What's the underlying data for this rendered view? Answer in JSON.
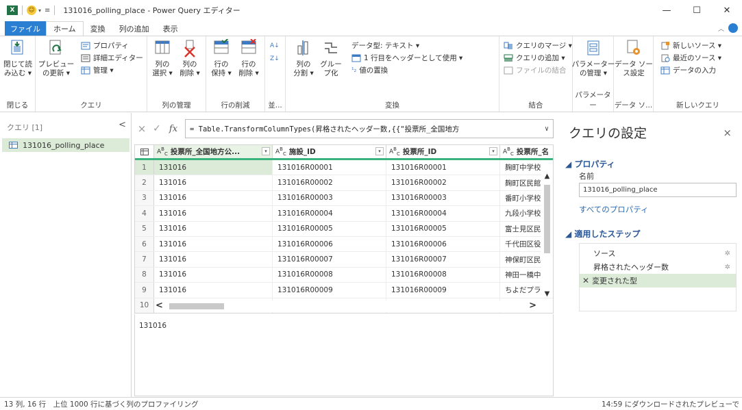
{
  "window": {
    "title": "131016_polling_place - Power Query エディター",
    "app_icon_text": "X",
    "smiley": "☺"
  },
  "ribbon_tabs": [
    "ファイル",
    "ホーム",
    "変換",
    "列の追加",
    "表示"
  ],
  "ribbon": {
    "close": {
      "load_label": "閉じて読\nみ込む ▾",
      "group": "閉じる"
    },
    "query": {
      "preview_label": "プレビュー\nの更新 ▾",
      "properties": "プロパティ",
      "advanced_editor": "詳細エディター",
      "manage": "管理 ▾",
      "group": "クエリ"
    },
    "manage_columns": {
      "choose": "列の\n選択 ▾",
      "remove": "列の\n削除 ▾",
      "group": "列の管理"
    },
    "reduce_rows": {
      "keep": "行の\n保持 ▾",
      "remove": "行の\n削除 ▾",
      "group": "行の削減"
    },
    "sort": {
      "group": "並..."
    },
    "transform": {
      "split": "列の\n分割 ▾",
      "group_by": "グルー\nプ化",
      "data_type": "データ型: テキスト ▾",
      "first_row_header": "1 行目をヘッダーとして使用 ▾",
      "replace_values": "値の置換",
      "group": "変換"
    },
    "combine": {
      "merge": "クエリのマージ ▾",
      "append": "クエリの追加 ▾",
      "combine_files": "ファイルの結合",
      "group": "結合"
    },
    "parameters": {
      "manage": "パラメーター\nの管理 ▾",
      "group": "パラメーター"
    },
    "data_source": {
      "settings": "データ ソー\nス設定",
      "group": "データ ソ..."
    },
    "new_query": {
      "new_source": "新しいソース ▾",
      "recent_source": "最近のソース ▾",
      "enter_data": "データの入力",
      "group": "新しいクエリ"
    }
  },
  "queries_pane": {
    "header": "クエリ [1]",
    "collapse": "<",
    "items": [
      "131016_polling_place"
    ]
  },
  "formula_bar": {
    "cancel": "×",
    "commit": "✓",
    "fx": "fx",
    "formula": "= Table.TransformColumnTypes(昇格されたヘッダー数,{{\"投票所_全国地方",
    "expand": "∨"
  },
  "grid": {
    "columns": [
      "投票所_全国地方公...",
      "施設_ID",
      "投票所_ID",
      "投票所_名"
    ],
    "rows": [
      [
        "1",
        "131016",
        "131016R00001",
        "131016R00001",
        "麹町中学校"
      ],
      [
        "2",
        "131016",
        "131016R00002",
        "131016R00002",
        "麹町区民館"
      ],
      [
        "3",
        "131016",
        "131016R00003",
        "131016R00003",
        "番町小学校"
      ],
      [
        "4",
        "131016",
        "131016R00004",
        "131016R00004",
        "九段小学校"
      ],
      [
        "5",
        "131016",
        "131016R00005",
        "131016R00005",
        "富士見区民"
      ],
      [
        "6",
        "131016",
        "131016R00006",
        "131016R00006",
        "千代田区役"
      ],
      [
        "7",
        "131016",
        "131016R00007",
        "131016R00007",
        "神保町区民"
      ],
      [
        "8",
        "131016",
        "131016R00008",
        "131016R00008",
        "神田一橋中"
      ],
      [
        "9",
        "131016",
        "131016R00009",
        "131016R00009",
        "ちよだプラッ"
      ],
      [
        "10",
        "",
        "",
        "",
        ""
      ]
    ]
  },
  "preview_value": "131016",
  "settings": {
    "title": "クエリの設定",
    "close": "×",
    "properties_header": "◢ プロパティ",
    "name_label": "名前",
    "name_value": "131016_polling_place",
    "all_properties": "すべてのプロパティ",
    "steps_header": "◢ 適用したステップ",
    "steps": [
      "ソース",
      "昇格されたヘッダー数",
      "変更された型"
    ]
  },
  "status": {
    "left": "13 列, 16 行　上位 1000 行に基づく列のプロファイリング",
    "right": "14:59 にダウンロードされたプレビューで"
  },
  "colors": {
    "file_tab": "#2b7fd3",
    "selection": "#dcebd8",
    "column_underline": "#3ab37e"
  }
}
